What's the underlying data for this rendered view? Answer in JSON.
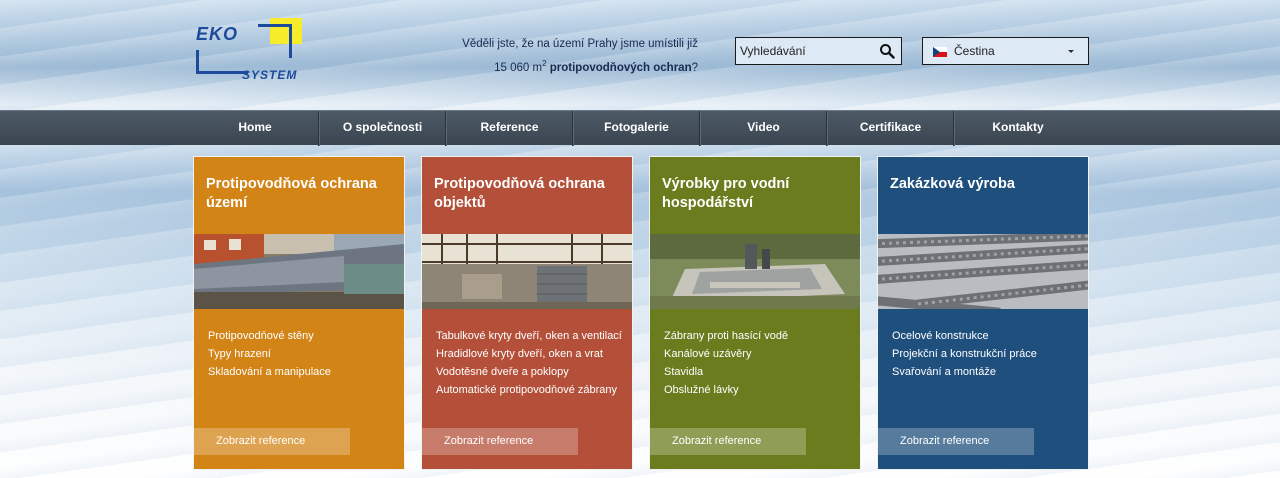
{
  "header": {
    "logo_line1": "EKO",
    "logo_line2": "SYSTEM",
    "fact_text_a": "Věděli jste, že na území Prahy jsme umístili již",
    "fact_text_b": "15 060 m",
    "fact_text_sup": "2",
    "fact_text_c": "protipovodňových ochran",
    "fact_text_d": "?",
    "search_placeholder": "Vyhledávání",
    "language": "Čestina"
  },
  "nav": {
    "items": [
      "Home",
      "O společnosti",
      "Reference",
      "Fotogalerie",
      "Video",
      "Certifikace",
      "Kontakty"
    ]
  },
  "cards": [
    {
      "title": "Protipovodňová ochrana území",
      "color": "#d28417",
      "links": [
        "Protipovodňové stěny",
        "Typy hrazení",
        "Skladování a manipulace"
      ],
      "button": "Zobrazit reference"
    },
    {
      "title": "Protipovodňová ochrana objektů",
      "color": "#b4503a",
      "links": [
        "Tabulkové kryty dveří, oken a ventilací",
        "Hradidlové kryty dveří, oken a vrat",
        "Vodotěsné dveře a poklopy",
        "Automatické protipovodňové zábrany"
      ],
      "button": "Zobrazit reference"
    },
    {
      "title": "Výrobky pro vodní hospodářství",
      "color": "#6a7c1e",
      "links": [
        "Zábrany proti hasící vodě",
        "Kanálové uzávěry",
        "Stavidla",
        "Obslužné lávky"
      ],
      "button": "Zobrazit reference"
    },
    {
      "title": "Zakázková výroba",
      "color": "#1e4f7d",
      "links": [
        "Ocelové konstrukce",
        "Projekční a konstrukční práce",
        "Svařování a montáže"
      ],
      "button": "Zobrazit reference"
    }
  ],
  "icons": {
    "search": "search-icon",
    "flag": "czech-flag-icon",
    "dropdown": "chevron-down-icon"
  }
}
